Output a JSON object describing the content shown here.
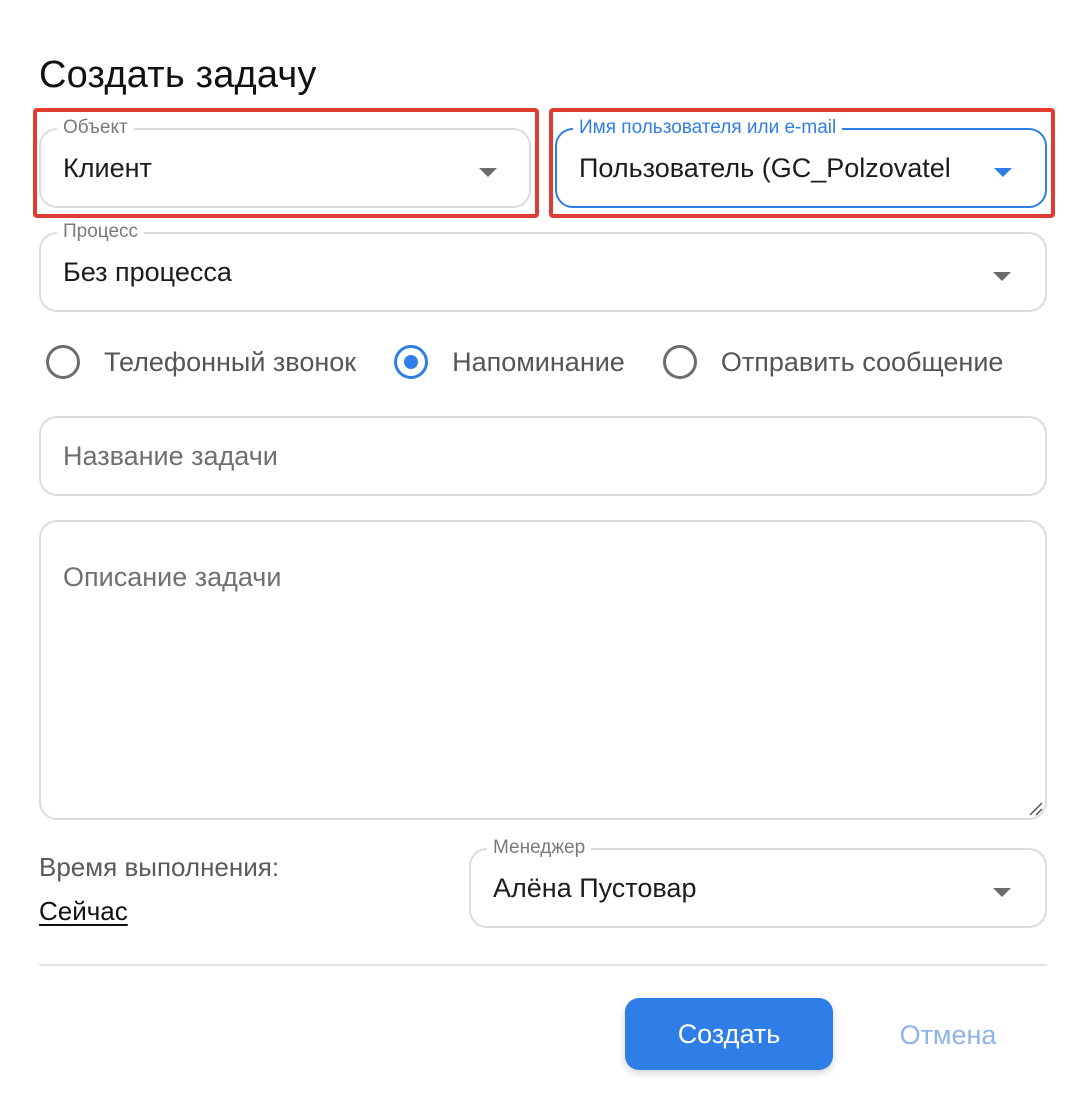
{
  "dialog": {
    "title": "Создать задачу"
  },
  "fields": {
    "object": {
      "legend": "Объект",
      "value": "Клиент"
    },
    "user": {
      "legend": "Имя пользователя или e-mail",
      "value": "Пользователь (GC_Polzovatel"
    },
    "process": {
      "legend": "Процесс",
      "value": "Без процесса"
    },
    "task_name": {
      "placeholder": "Название задачи",
      "value": ""
    },
    "task_description": {
      "placeholder": "Описание задачи",
      "value": ""
    },
    "manager": {
      "legend": "Менеджер",
      "value": "Алёна Пустовар"
    }
  },
  "task_type": {
    "options": [
      "Телефонный звонок",
      "Напоминание",
      "Отправить сообщение"
    ],
    "selected": "Напоминание"
  },
  "due_time": {
    "label": "Время выполнения:",
    "value": "Сейчас"
  },
  "actions": {
    "create": "Создать",
    "cancel": "Отмена"
  },
  "colors": {
    "accent": "#2f7ee8",
    "highlight": "#e03c31",
    "border": "#dcdcdc"
  }
}
